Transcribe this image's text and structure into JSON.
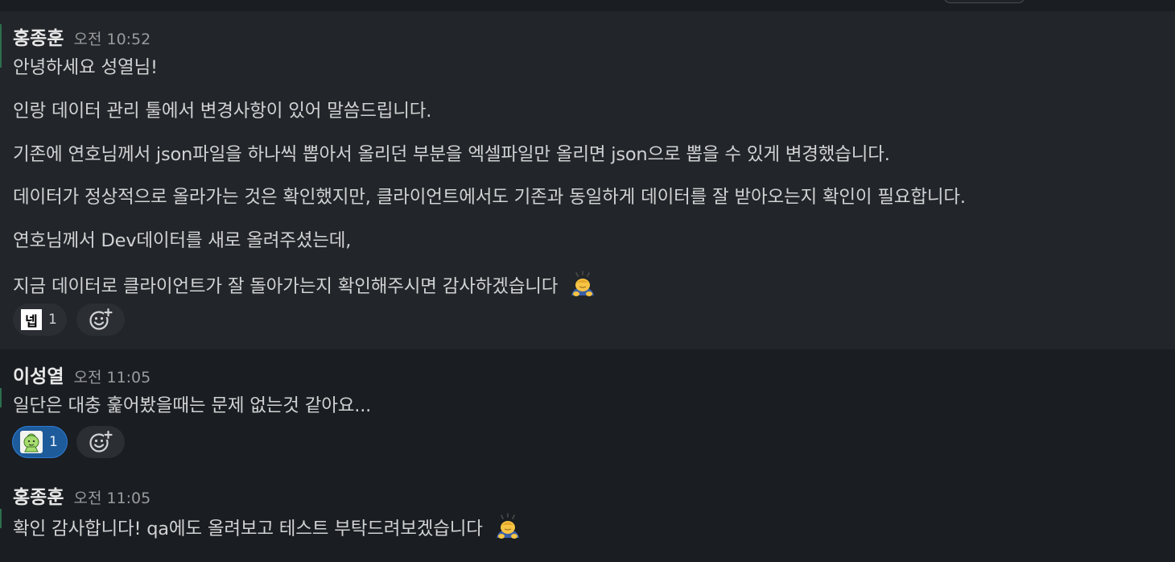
{
  "messages": [
    {
      "author": "홍종훈",
      "time": "오전 10:52",
      "lines": [
        "안녕하세요 성열님!",
        "인랑 데이터 관리 툴에서 변경사항이 있어 말씀드립니다.",
        "기존에 연호님께서 json파일을 하나씩 뽑아서 올리던 부분을 엑셀파일만 올리면 json으로 뽑을 수 있게 변경했습니다.",
        "데이터가 정상적으로 올라가는 것은 확인했지만, 클라이언트에서도 기존과 동일하게 데이터를 잘 받아오는지 확인이 필요합니다.",
        "연호님께서 Dev데이터를 새로 올려주셨는데,",
        "지금 데이터로 클라이언트가 잘 돌아가는지 확인해주시면 감사하겠습니다"
      ],
      "trailing_emoji": "bowing-person-emoji",
      "reaction": {
        "glyph": "넵",
        "count": "1",
        "icon": "nep-custom-emoji"
      }
    },
    {
      "author": "이성열",
      "time": "오전 11:05",
      "lines": [
        "일단은 대충 훑어봤을때는 문제 없는것 같아요..."
      ],
      "reaction": {
        "count": "1",
        "icon": "green-character-custom-emoji",
        "active": true
      }
    },
    {
      "author": "홍종훈",
      "time": "오전 11:05",
      "lines": [
        "확인 감사합니다! qa에도 올려보고 테스트 부탁드려보겠습니다"
      ],
      "trailing_emoji": "bowing-person-emoji"
    }
  ],
  "icons": {
    "add_reaction": "add-reaction-icon"
  },
  "colors": {
    "background": "#1a1d21",
    "hover_background": "#222529",
    "active_reaction": "#1d5b9b",
    "text": "#d1d2d3",
    "timestamp": "#9a9b9d"
  }
}
